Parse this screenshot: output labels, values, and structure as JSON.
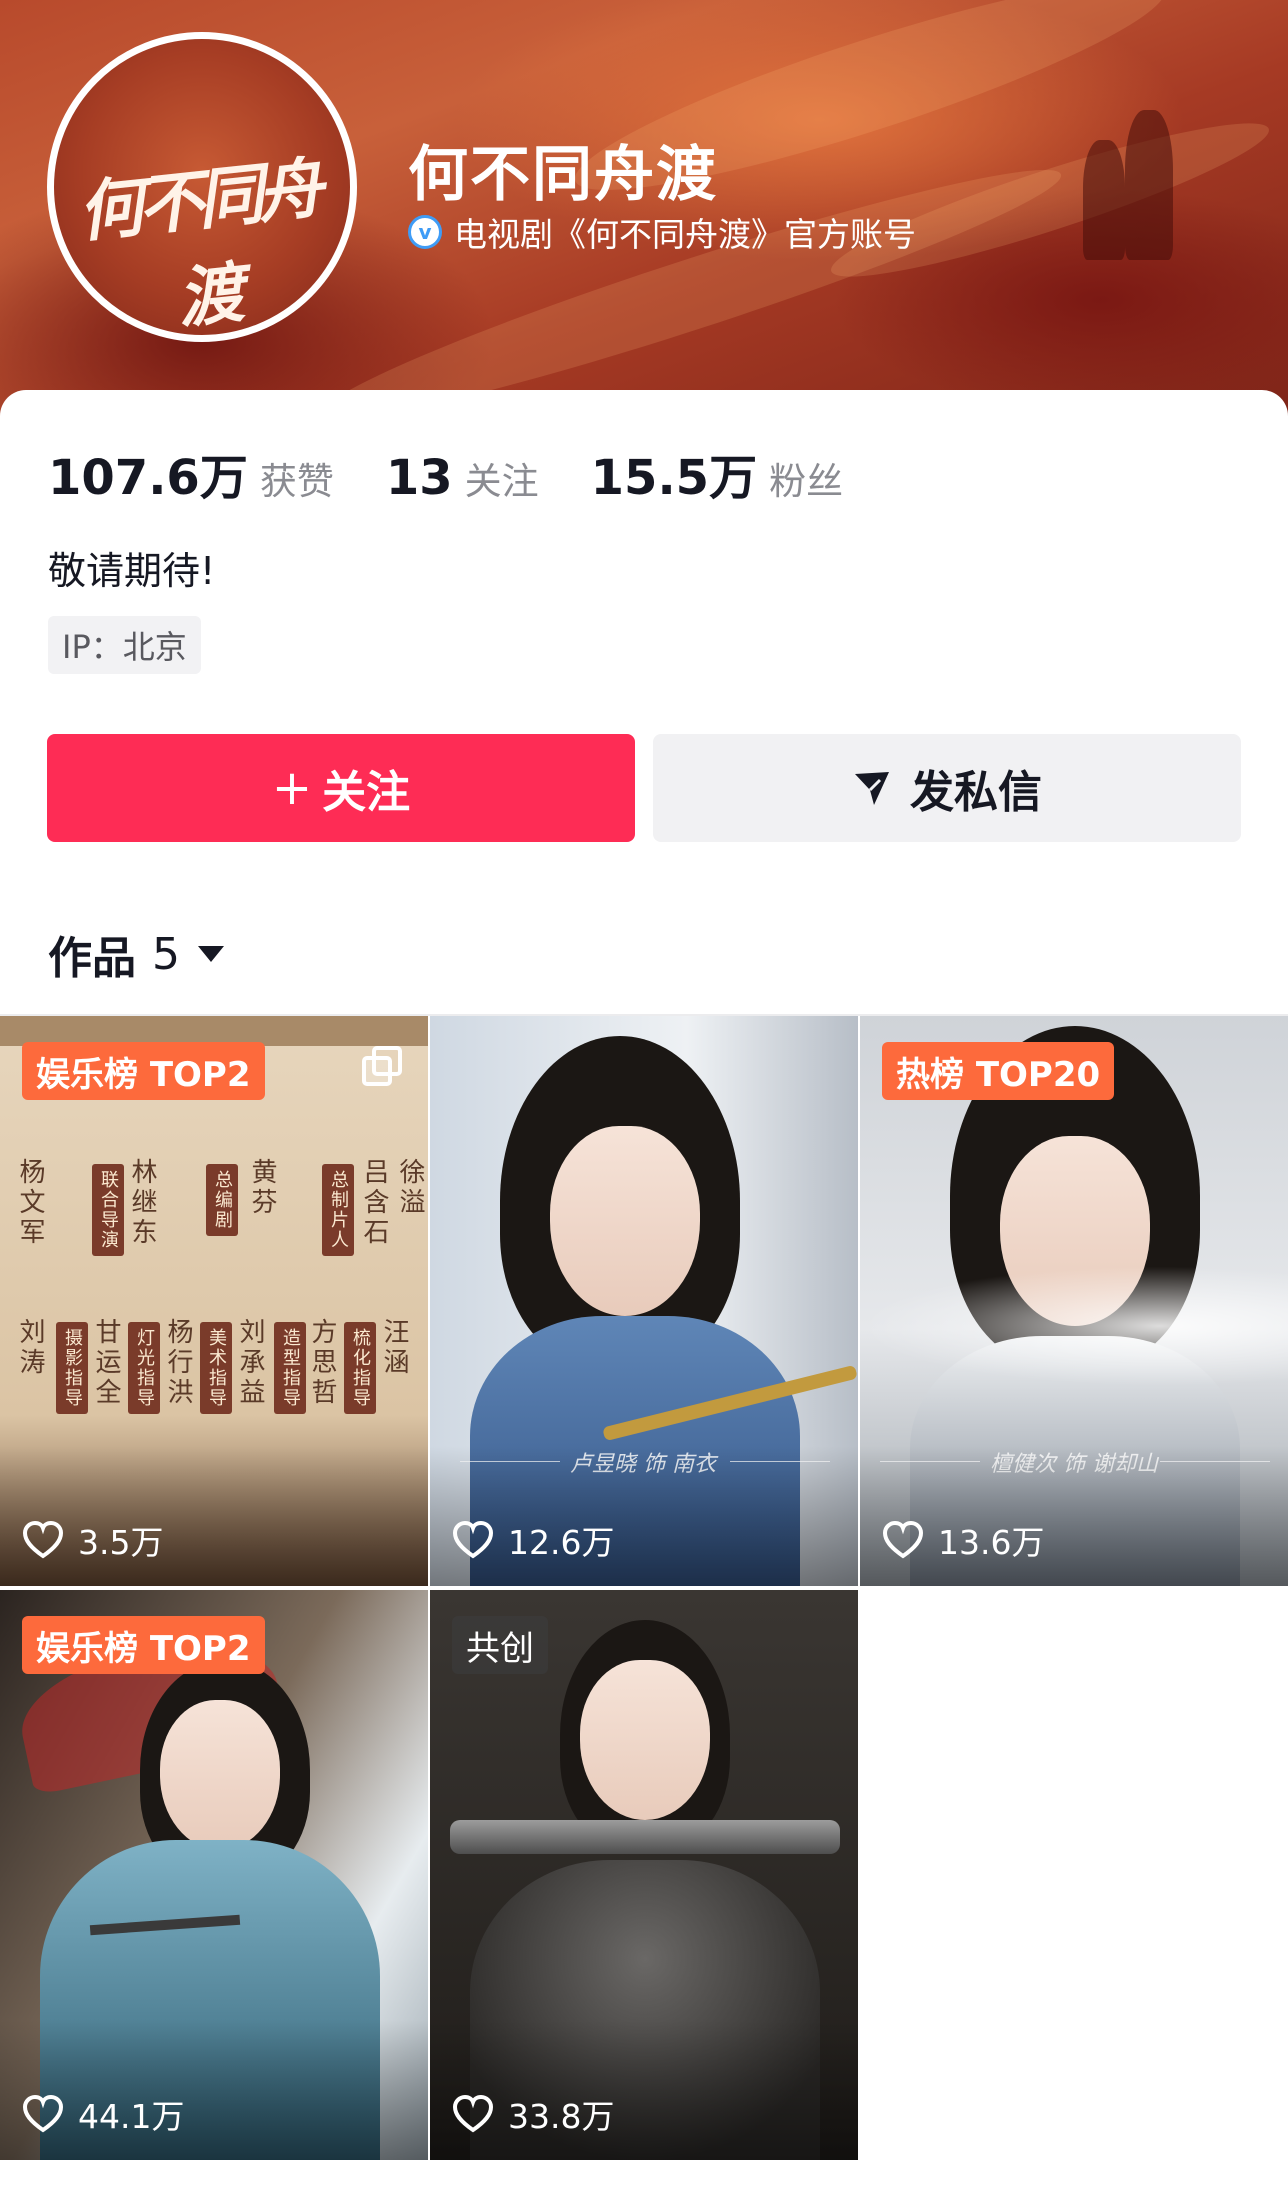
{
  "profile": {
    "avatar_logo_text": "何不同舟渡",
    "name": "何不同舟渡",
    "verified_icon": "verified-v-icon",
    "verified_text": "电视剧《何不同舟渡》官方账号"
  },
  "stats": {
    "likes": {
      "value": "107.6万",
      "label": "获赞"
    },
    "following": {
      "value": "13",
      "label": "关注"
    },
    "followers": {
      "value": "15.5万",
      "label": "粉丝"
    }
  },
  "bio": "敬请期待!",
  "ip_tag": "IP：北京",
  "actions": {
    "follow_label": "关注",
    "follow_icon": "plus-icon",
    "message_label": "发私信",
    "message_icon": "paper-plane-icon"
  },
  "works": {
    "label": "作品",
    "count": "5",
    "caret_icon": "caret-down-icon"
  },
  "videos": [
    {
      "badge": "娱乐榜 TOP2",
      "likes": "3.5万",
      "multi_image": true,
      "credits": {
        "names_top": [
          "杨文军",
          "林继东",
          "黄芬",
          "吕含石",
          "徐溢"
        ],
        "tags_top": [
          "联合导演",
          "总编剧",
          "总制片人"
        ],
        "names_bottom": [
          "刘涛",
          "甘运全",
          "杨行洪",
          "刘承益",
          "方思哲",
          "汪涵"
        ],
        "tags_bottom": [
          "摄影指导",
          "灯光指导",
          "美术指导",
          "造型指导",
          "梳化指导"
        ]
      }
    },
    {
      "badge": "",
      "likes": "12.6万"
    },
    {
      "badge": "热榜 TOP20",
      "likes": "13.6万"
    },
    {
      "badge": "娱乐榜 TOP2",
      "likes": "44.1万"
    },
    {
      "badge": "共创",
      "likes": "33.8万"
    }
  ],
  "icons": {
    "heart": "heart-icon",
    "multi": "multi-image-icon"
  },
  "colors": {
    "accent": "#fe2c55",
    "badge": "#fd6a3c",
    "verified": "#3f9cf6"
  }
}
